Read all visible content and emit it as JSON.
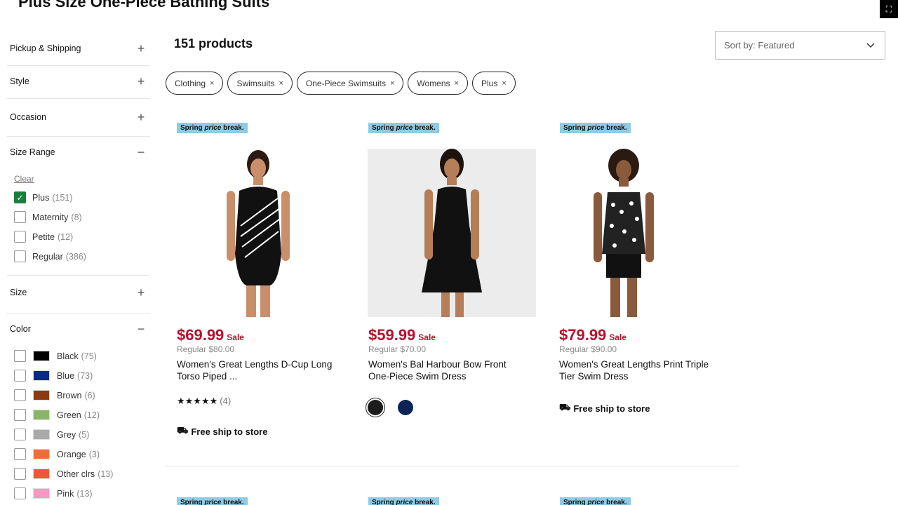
{
  "page": {
    "title": "Plus Size One-Piece Bathing Suits",
    "product_count": "151 products"
  },
  "sort": {
    "label": "Sort by: Featured"
  },
  "chips": [
    {
      "label": "Clothing"
    },
    {
      "label": "Swimsuits"
    },
    {
      "label": "One-Piece Swimsuits"
    },
    {
      "label": "Womens"
    },
    {
      "label": "Plus"
    }
  ],
  "facets": {
    "pickup": "Pickup & Shipping",
    "style": "Style",
    "occasion": "Occasion",
    "size_range": "Size Range",
    "clear": "Clear",
    "size": "Size",
    "color": "Color"
  },
  "size_range_options": [
    {
      "label": "Plus",
      "count": "(151)",
      "checked": true
    },
    {
      "label": "Maternity",
      "count": "(8)",
      "checked": false
    },
    {
      "label": "Petite",
      "count": "(12)",
      "checked": false
    },
    {
      "label": "Regular",
      "count": "(386)",
      "checked": false
    }
  ],
  "color_options": [
    {
      "label": "Black",
      "count": "(75)",
      "swatch": "#000000"
    },
    {
      "label": "Blue",
      "count": "(73)",
      "swatch": "#0a2a8a"
    },
    {
      "label": "Brown",
      "count": "(6)",
      "swatch": "#8b3a12"
    },
    {
      "label": "Green",
      "count": "(12)",
      "swatch": "#88b56a"
    },
    {
      "label": "Grey",
      "count": "(5)",
      "swatch": "#a9a9a9"
    },
    {
      "label": "Orange",
      "count": "(3)",
      "swatch": "#f26b3a"
    },
    {
      "label": "Other clrs",
      "count": "(13)",
      "swatch": "#f0573a"
    },
    {
      "label": "Pink",
      "count": "(13)",
      "swatch": "#f49ac1"
    }
  ],
  "products": [
    {
      "promo_a": "Spring ",
      "promo_b": "price",
      "promo_c": " break.",
      "price": "$69.99",
      "sale": "Sale",
      "regular": "Regular $80.00",
      "name_1": "Women's Great Lengths D-Cup Long",
      "name_2": "Torso Piped ...",
      "stars": "★★★★★",
      "rating_count": "(4)",
      "ship": "Free ship to store"
    },
    {
      "promo_a": "Spring ",
      "promo_b": "price",
      "promo_c": " break.",
      "price": "$59.99",
      "sale": "Sale",
      "regular": "Regular $70.00",
      "name_1": "Women's Bal Harbour Bow Front",
      "name_2": "One-Piece Swim Dress"
    },
    {
      "promo_a": "Spring ",
      "promo_b": "price",
      "promo_c": " break.",
      "price": "$79.99",
      "sale": "Sale",
      "regular": "Regular $90.00",
      "name_1": "Women's Great Lengths Print Triple",
      "name_2": "Tier Swim Dress",
      "ship": "Free ship to store"
    }
  ],
  "colors": {
    "sale_red": "#b5122b",
    "promo_blue": "#8fcbe5",
    "check_green": "#1a7f3c"
  }
}
